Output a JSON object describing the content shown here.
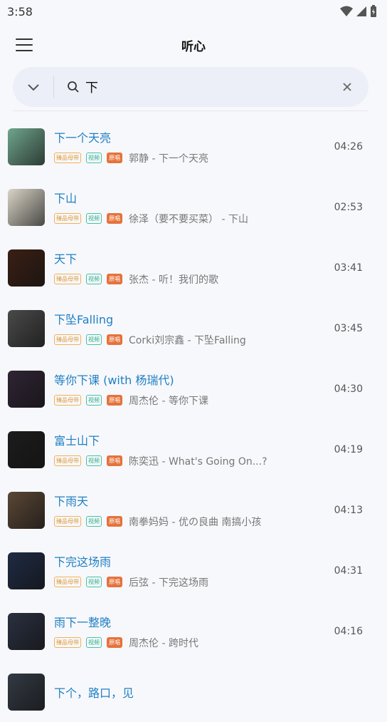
{
  "status": {
    "time": "3:58"
  },
  "appbar": {
    "title": "听心"
  },
  "search": {
    "value": "下"
  },
  "tags": {
    "quality": "臻品母带",
    "video": "视频",
    "original": "原唱"
  },
  "songs": [
    {
      "title": "下一个天亮",
      "subtitle": "郭静 - 下一个天亮",
      "duration": "04:26",
      "cover": "#6fa58d"
    },
    {
      "title": "下山",
      "subtitle": "徐泽（要不要买菜） - 下山",
      "duration": "02:53",
      "cover": "#d9d4c7"
    },
    {
      "title": "天下",
      "subtitle": "张杰 - 听！我们的歌",
      "duration": "03:41",
      "cover": "#3a1f14"
    },
    {
      "title": "下坠Falling",
      "subtitle": "Corki刘宗鑫 - 下坠Falling",
      "duration": "03:45",
      "cover": "#4a4a4a"
    },
    {
      "title": "等你下课 (with 杨瑞代)",
      "subtitle": "周杰伦 - 等你下课",
      "duration": "04:30",
      "cover": "#2f2434"
    },
    {
      "title": "富士山下",
      "subtitle": "陈奕迅 - What's Going On...?",
      "duration": "04:19",
      "cover": "#1c1c1c"
    },
    {
      "title": "下雨天",
      "subtitle": "南拳妈妈 - 优の良曲 南搞小孩",
      "duration": "04:13",
      "cover": "#5a4735"
    },
    {
      "title": "下完这场雨",
      "subtitle": "后弦 - 下完这场雨",
      "duration": "04:31",
      "cover": "#1f2b44"
    },
    {
      "title": "雨下一整晚",
      "subtitle": "周杰伦 - 跨时代",
      "duration": "04:16",
      "cover": "#2a3040"
    },
    {
      "title": "下个，路口，见",
      "subtitle": "",
      "duration": "",
      "cover": "#333a44"
    }
  ]
}
